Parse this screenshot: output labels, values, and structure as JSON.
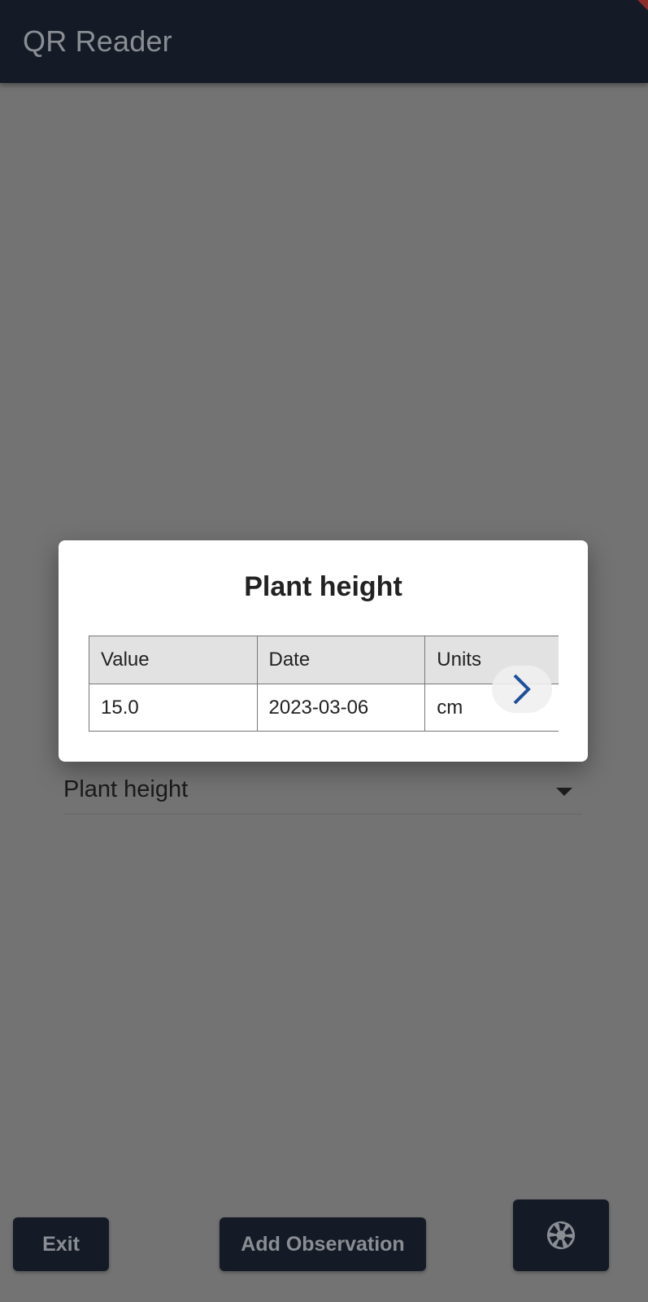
{
  "app_bar": {
    "title": "QR Reader"
  },
  "dropdown": {
    "selected": "Plant height"
  },
  "dialog": {
    "title": "Plant height",
    "table": {
      "headers": [
        "Value",
        "Date",
        "Units"
      ],
      "rows": [
        [
          "15.0",
          "2023-03-06",
          "cm"
        ]
      ]
    }
  },
  "buttons": {
    "exit_label": "Exit",
    "add_observation_label": "Add Observation",
    "camera_icon": "camera-shutter-icon"
  },
  "colors": {
    "app_bar": "#151b26",
    "scrim_background": "#737373",
    "dialog": "#ffffff",
    "header_cell": "#e2e2e2",
    "arrow": "#1f4f9c"
  }
}
